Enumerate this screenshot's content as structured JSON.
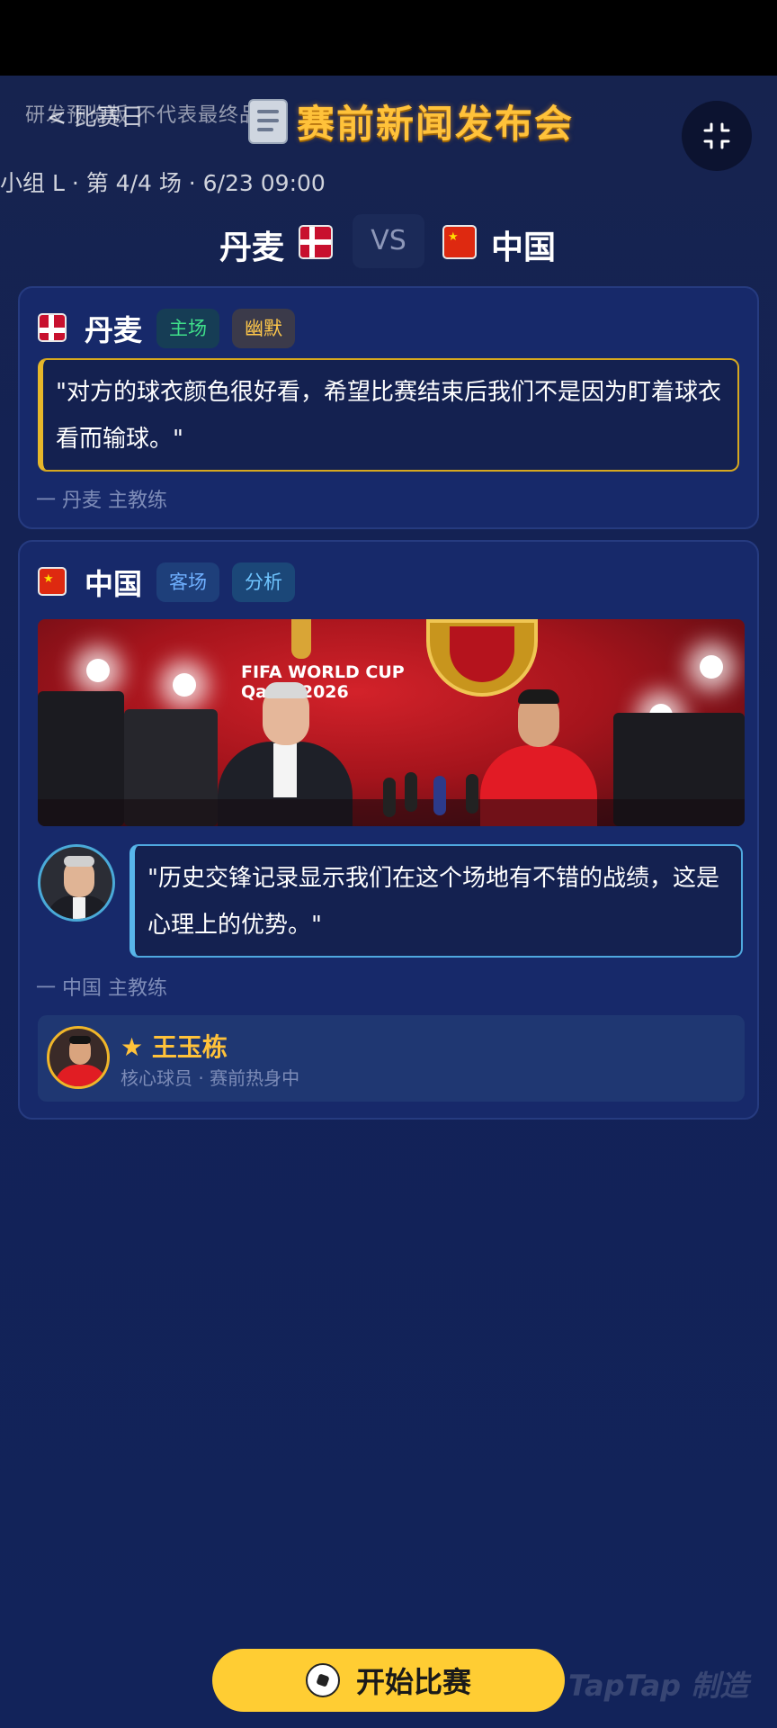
{
  "header": {
    "watermark": "研发预览版 不代表最终品质",
    "back_label": "< 比赛日",
    "title": "赛前新闻发布会",
    "collapse_icon": "collapse-icon",
    "doc_icon": "newspaper-icon"
  },
  "match": {
    "meta": "小组 L · 第 4/4 场 · 6/23 09:00",
    "home_team": "丹麦",
    "vs": "VS",
    "away_team": "中国"
  },
  "home_card": {
    "team": "丹麦",
    "tags": [
      "主场",
      "幽默"
    ],
    "quote": "\"对方的球衣颜色很好看，希望比赛结束后我们不是因为盯着球衣看而输球。\"",
    "attribution": "一 丹麦 主教练",
    "accent_color": "#e6b72a"
  },
  "away_card": {
    "team": "中国",
    "tags": [
      "客场",
      "分析"
    ],
    "photo_text": "FIFA WORLD CUP\nQatar 2026",
    "quote": "\"历史交锋记录显示我们在这个场地有不错的战绩，这是心理上的优势。\"",
    "attribution": "一 中国 主教练",
    "accent_color": "#58b6ea",
    "key_player": {
      "name": "王玉栋",
      "subtitle": "核心球员 · 赛前热身中",
      "icon": "star-icon"
    }
  },
  "footer": {
    "start_label": "开始比赛",
    "ball_icon": "soccer-ball-icon",
    "brand_watermark": "TapTap 制造"
  },
  "colors": {
    "background": "#122050",
    "title_gold": "#ffc23a",
    "button_yellow": "#ffcd33"
  }
}
